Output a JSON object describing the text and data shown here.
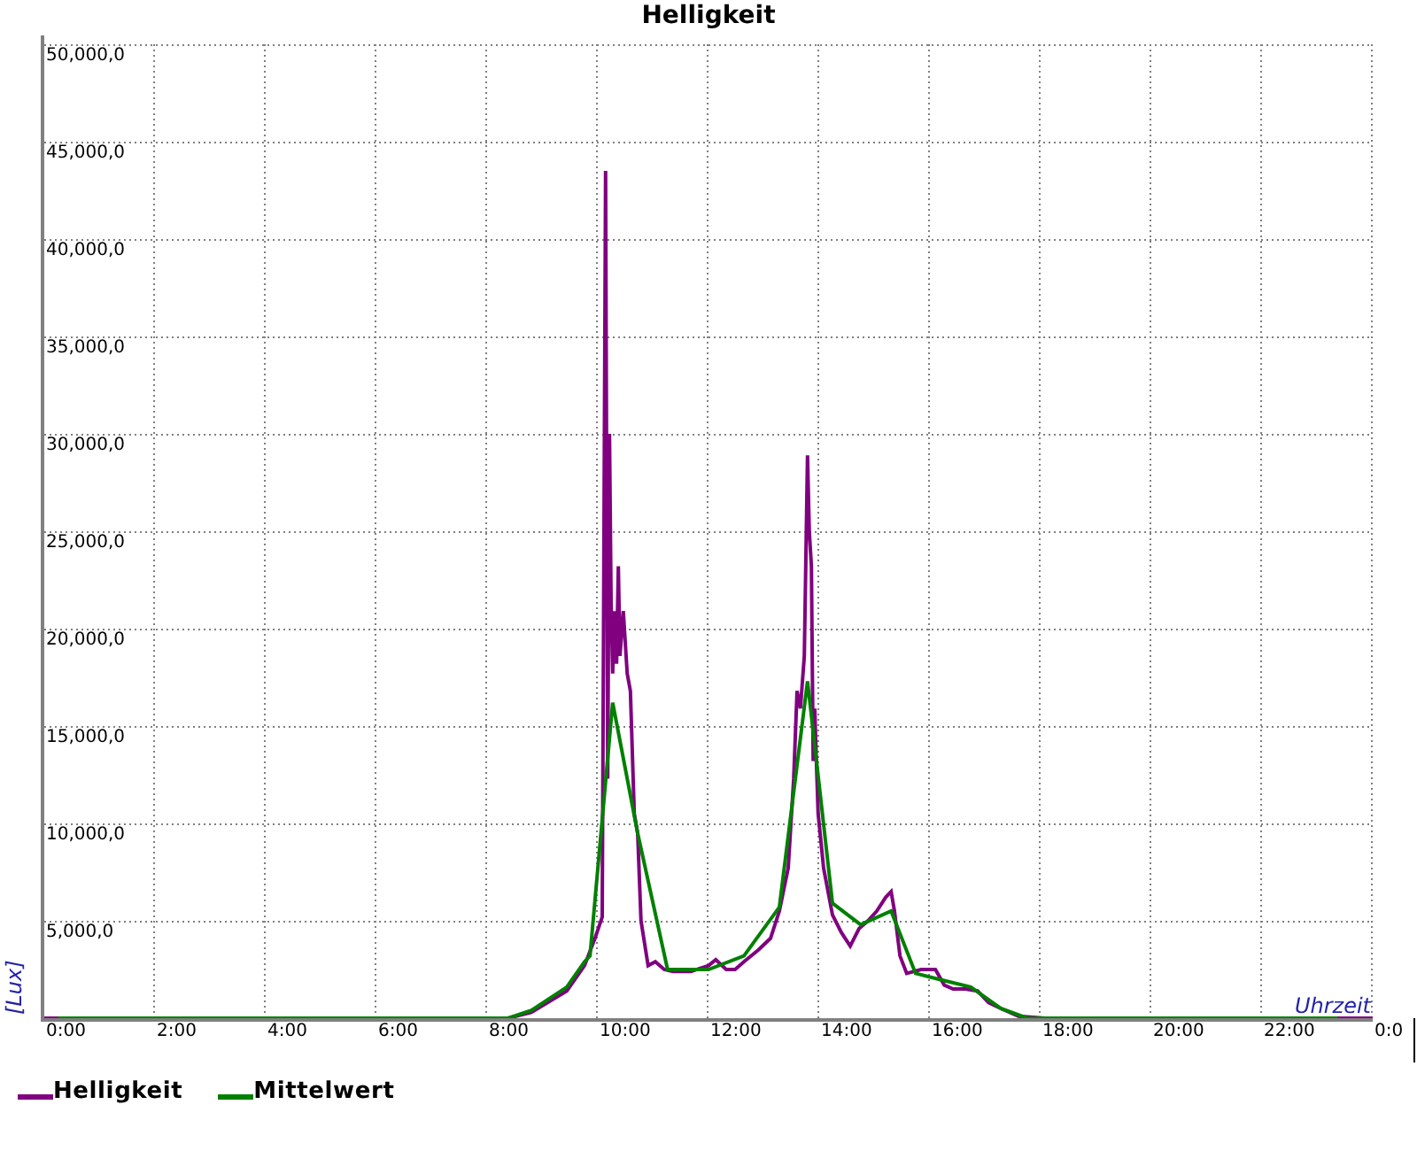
{
  "chart": {
    "title": "Helligkeit",
    "x_axis_title": "Uhrzeit",
    "y_axis_title": "[Lux]",
    "x_axis_labels": [
      "0:00",
      "2:00",
      "4:00",
      "6:00",
      "8:00",
      "10:00",
      "12:00",
      "14:00",
      "16:00",
      "18:00",
      "20:00",
      "22:00",
      "0:0"
    ],
    "y_axis_labels": [
      "50,000,0",
      "45,000,0",
      "40,000,0",
      "35,000,0",
      "30,000,0",
      "25,000,0",
      "20,000,0",
      "15,000,0",
      "10,000,0",
      "5,000,0"
    ]
  },
  "legend": [
    {
      "label": "Helligkeit",
      "color": "#800080"
    },
    {
      "label": "Mittelwert",
      "color": "#008000"
    }
  ]
}
